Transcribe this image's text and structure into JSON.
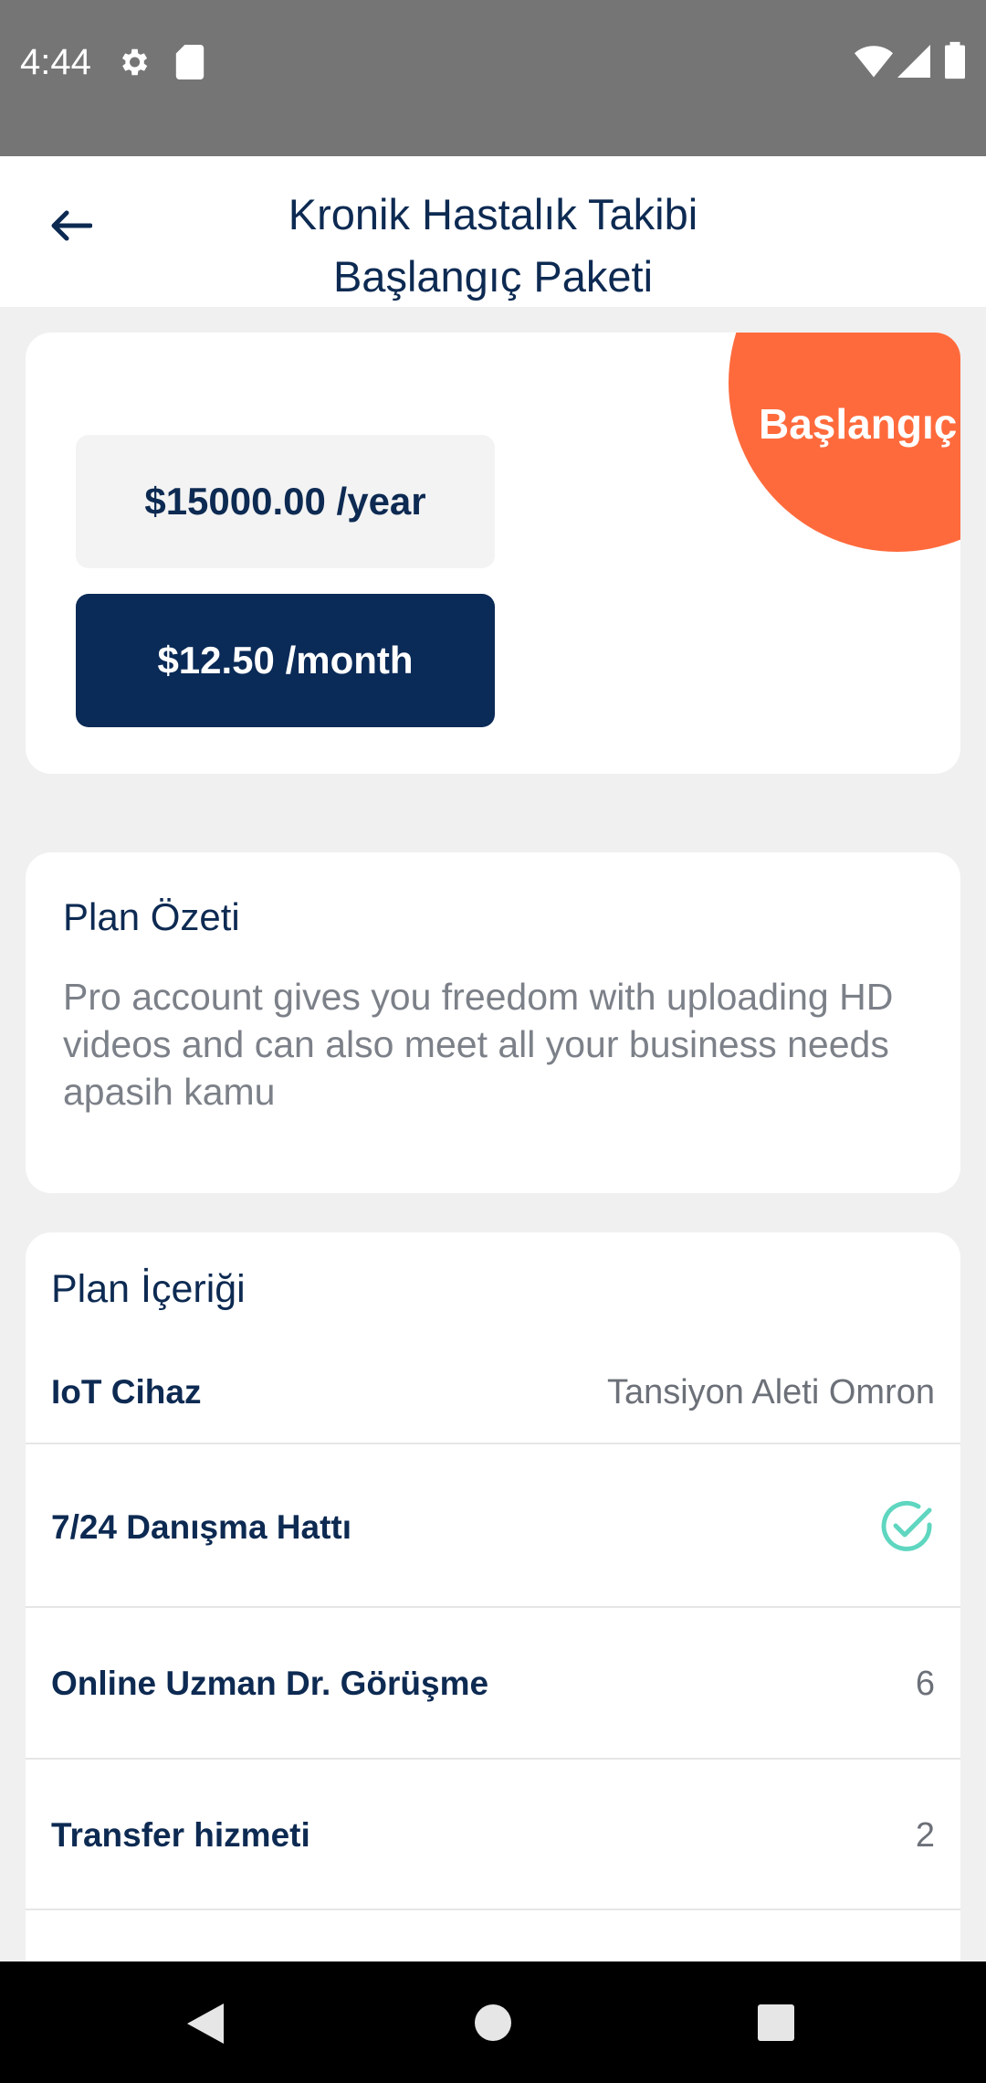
{
  "status_bar": {
    "time": "4:44"
  },
  "header": {
    "title_line1": "Kronik Hastalık Takibi",
    "title_line2": "Başlangıç Paketi"
  },
  "price": {
    "badge": "Başlangıç",
    "yearly": "$15000.00 /year",
    "monthly": "$12.50 /month"
  },
  "summary": {
    "title": "Plan Özeti",
    "text": "Pro account gives you freedom with uploading HD videos and can also meet all your business needs apasih kamu"
  },
  "content": {
    "title": "Plan İçeriği",
    "rows": [
      {
        "label": "IoT Cihaz",
        "value": "Tansiyon Aleti Omron"
      },
      {
        "label": "7/24 Danışma Hattı",
        "value": "check-circle-icon"
      },
      {
        "label": "Online Uzman Dr. Görüşme",
        "value": "6"
      },
      {
        "label": "Transfer hizmeti",
        "value": "2"
      }
    ]
  },
  "colors": {
    "primary": "#0a2a57",
    "badge": "#ff6a3c",
    "check": "#5fd6c0"
  }
}
